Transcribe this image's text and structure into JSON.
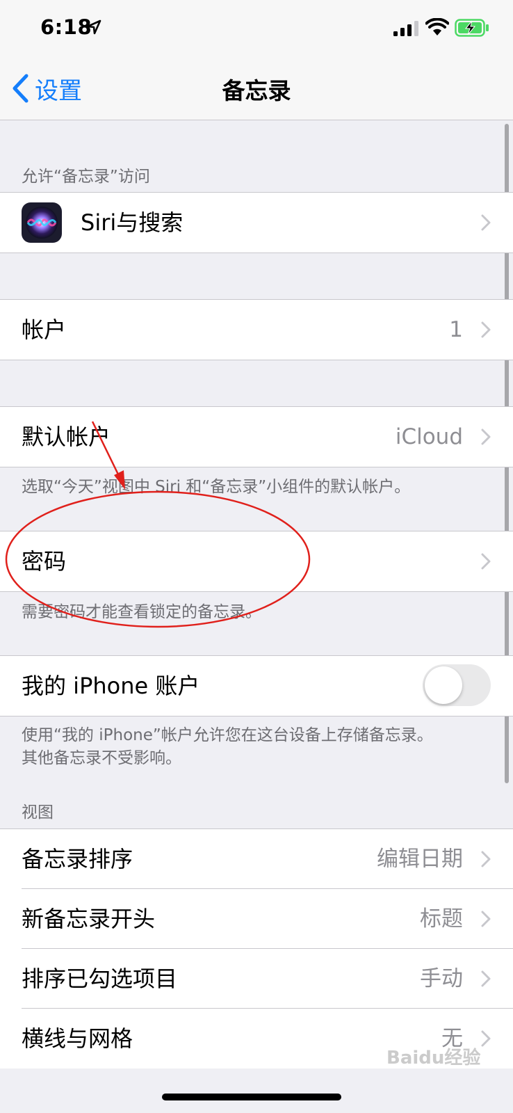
{
  "status": {
    "time": "6:18"
  },
  "nav": {
    "back_label": "设置",
    "title": "备忘录"
  },
  "allow_access": {
    "header": "允许“备忘录”访问",
    "siri_label": "Siri与搜索"
  },
  "accounts": {
    "label": "帐户",
    "value": "1"
  },
  "default_account": {
    "label": "默认帐户",
    "value": "iCloud",
    "footer": "选取“今天”视图中 Siri 和“备忘录”小组件的默认帐户。"
  },
  "password": {
    "label": "密码",
    "footer": "需要密码才能查看锁定的备忘录。"
  },
  "iphone_account": {
    "label": "我的 iPhone 账户",
    "enabled": false,
    "footer_line1": "使用“我的 iPhone”帐户允许您在这台设备上存储备忘录。",
    "footer_line2": "其他备忘录不受影响。"
  },
  "view": {
    "header": "视图",
    "rows": [
      {
        "label": "备忘录排序",
        "value": "编辑日期"
      },
      {
        "label": "新备忘录开头",
        "value": "标题"
      },
      {
        "label": "排序已勾选项目",
        "value": "手动"
      },
      {
        "label": "横线与网格",
        "value": "无"
      }
    ]
  },
  "watermark": "Baidu经验",
  "colors": {
    "accent": "#147efb",
    "annotation": "#e0201b",
    "background": "#efeff4"
  }
}
